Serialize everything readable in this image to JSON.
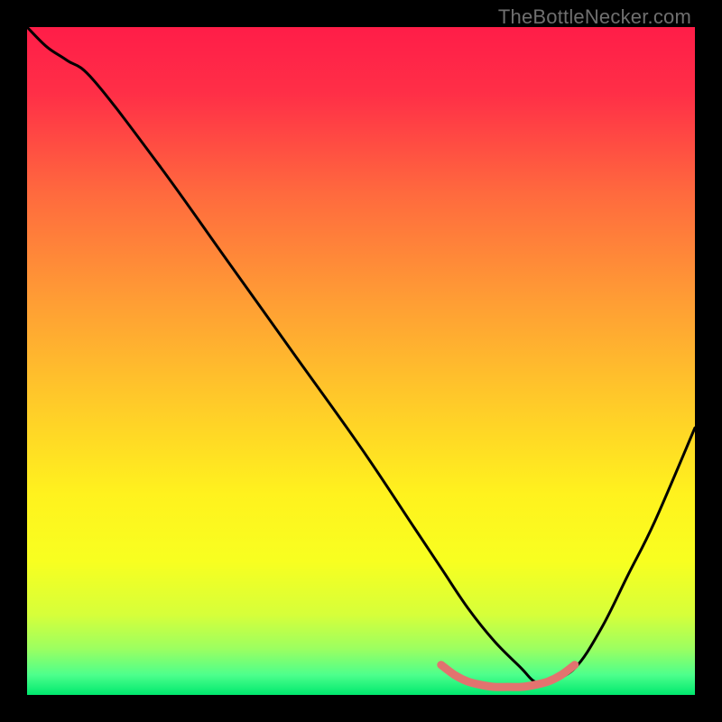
{
  "watermark": "TheBottleNecker.com",
  "colors": {
    "bg": "#000000",
    "gradient_stops": [
      {
        "offset": 0.0,
        "color": "#ff1d48"
      },
      {
        "offset": 0.1,
        "color": "#ff2f47"
      },
      {
        "offset": 0.25,
        "color": "#ff6a3e"
      },
      {
        "offset": 0.4,
        "color": "#ff9a35"
      },
      {
        "offset": 0.55,
        "color": "#ffc72a"
      },
      {
        "offset": 0.7,
        "color": "#fff21e"
      },
      {
        "offset": 0.8,
        "color": "#f8ff20"
      },
      {
        "offset": 0.88,
        "color": "#d6ff3a"
      },
      {
        "offset": 0.93,
        "color": "#9dff60"
      },
      {
        "offset": 0.97,
        "color": "#4dff8c"
      },
      {
        "offset": 1.0,
        "color": "#00e86e"
      }
    ],
    "curve_main": "#000000",
    "sweet_spot": "#e2736f"
  },
  "chart_data": {
    "type": "line",
    "title": "",
    "xlabel": "",
    "ylabel": "",
    "xlim": [
      0,
      100
    ],
    "ylim": [
      0,
      100
    ],
    "grid": false,
    "series": [
      {
        "name": "bottleneck-curve",
        "x": [
          0,
          3,
          6,
          10,
          20,
          30,
          40,
          50,
          58,
          62,
          66,
          70,
          74,
          76,
          78,
          82,
          86,
          90,
          94,
          100
        ],
        "values": [
          100,
          97,
          95,
          92,
          79,
          65,
          51,
          37,
          25,
          19,
          13,
          8,
          4,
          2,
          2,
          4,
          10,
          18,
          26,
          40
        ]
      },
      {
        "name": "sweet-spot-band",
        "x": [
          62,
          64,
          66,
          68,
          70,
          72,
          74,
          76,
          78,
          80,
          82
        ],
        "values": [
          4.5,
          3.0,
          2.0,
          1.5,
          1.2,
          1.2,
          1.2,
          1.5,
          2.0,
          3.0,
          4.5
        ]
      }
    ],
    "annotations": []
  }
}
